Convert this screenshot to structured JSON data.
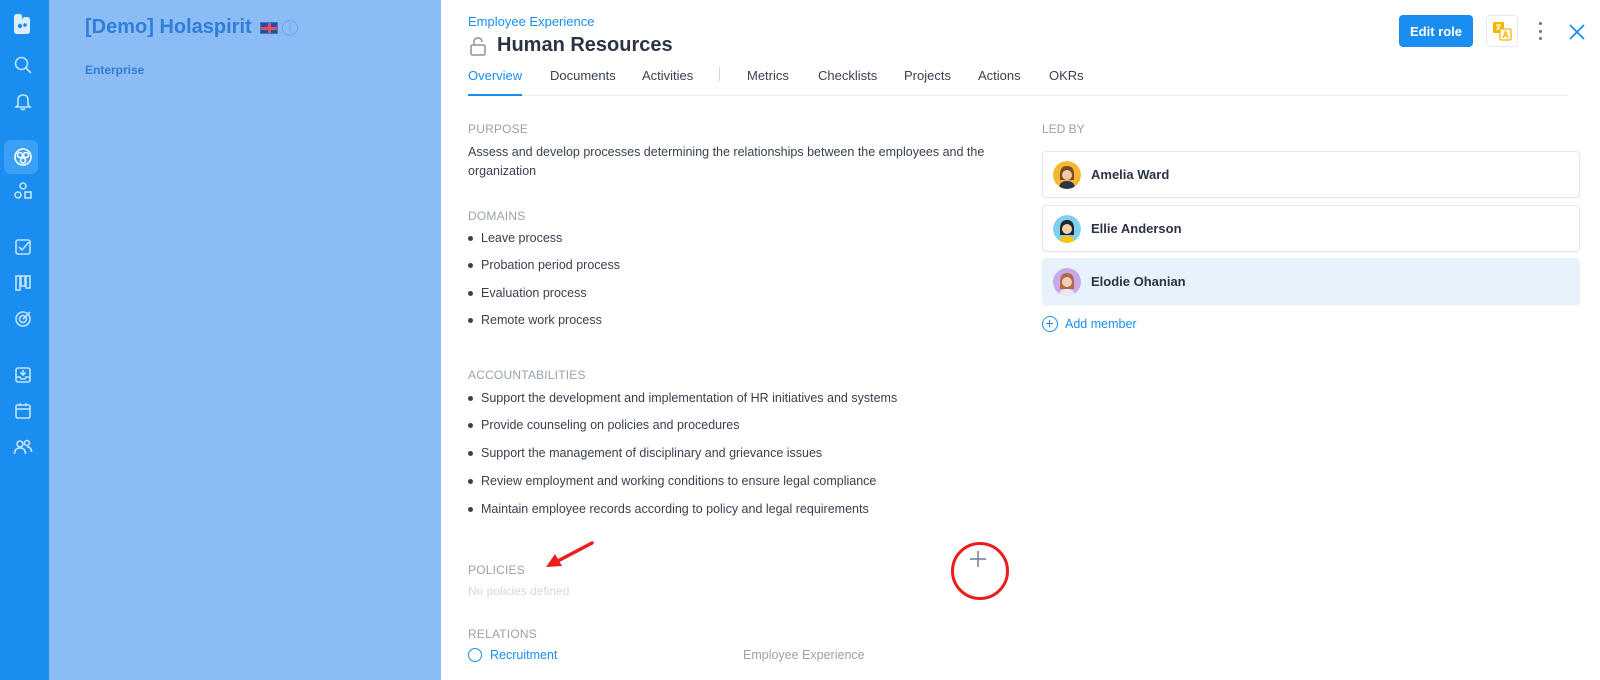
{
  "sidebar": {
    "icons": [
      "logo-icon",
      "search-icon",
      "bell-icon",
      "organization-icon",
      "roles-icon",
      "checklist-icon",
      "kanban-icon",
      "target-icon",
      "inbox-icon",
      "calendar-icon",
      "people-icon"
    ]
  },
  "org": {
    "title": "[Demo] Holaspirit",
    "subtitle": "Enterprise",
    "info": "i"
  },
  "header": {
    "breadcrumb": "Employee Experience",
    "title": "Human Resources",
    "edit_label": "Edit role"
  },
  "tabs": [
    {
      "label": "Overview"
    },
    {
      "label": "Documents"
    },
    {
      "label": "Activities"
    },
    {
      "label": "Metrics"
    },
    {
      "label": "Checklists"
    },
    {
      "label": "Projects"
    },
    {
      "label": "Actions"
    },
    {
      "label": "OKRs"
    }
  ],
  "purpose": {
    "label": "PURPOSE",
    "line1": "Assess and develop processes determining the relationships between the employees and the",
    "line2": "organization"
  },
  "domains": {
    "label": "DOMAINS",
    "items": [
      "Leave process",
      "Probation period process",
      "Evaluation process",
      "Remote work process"
    ]
  },
  "accountabilities": {
    "label": "ACCOUNTABILITIES",
    "items": [
      "Support the development and implementation of HR initiatives and systems",
      "Provide counseling on policies and procedures",
      "Support the management of disciplinary and grievance issues",
      "Review employment and working conditions to ensure legal compliance",
      "Maintain employee records according to policy and legal requirements"
    ]
  },
  "policies": {
    "label": "POLICIES",
    "empty": "No policies defined"
  },
  "relations": {
    "label": "RELATIONS",
    "role": "Recruitment",
    "circle": "Employee Experience"
  },
  "led_by": {
    "label": "LED BY",
    "members": [
      "Amelia Ward",
      "Ellie Anderson",
      "Elodie Ohanian"
    ],
    "add_label": "Add member"
  },
  "colors": {
    "accent": "#1a8ef0",
    "annotation": "#ec1c1c"
  }
}
